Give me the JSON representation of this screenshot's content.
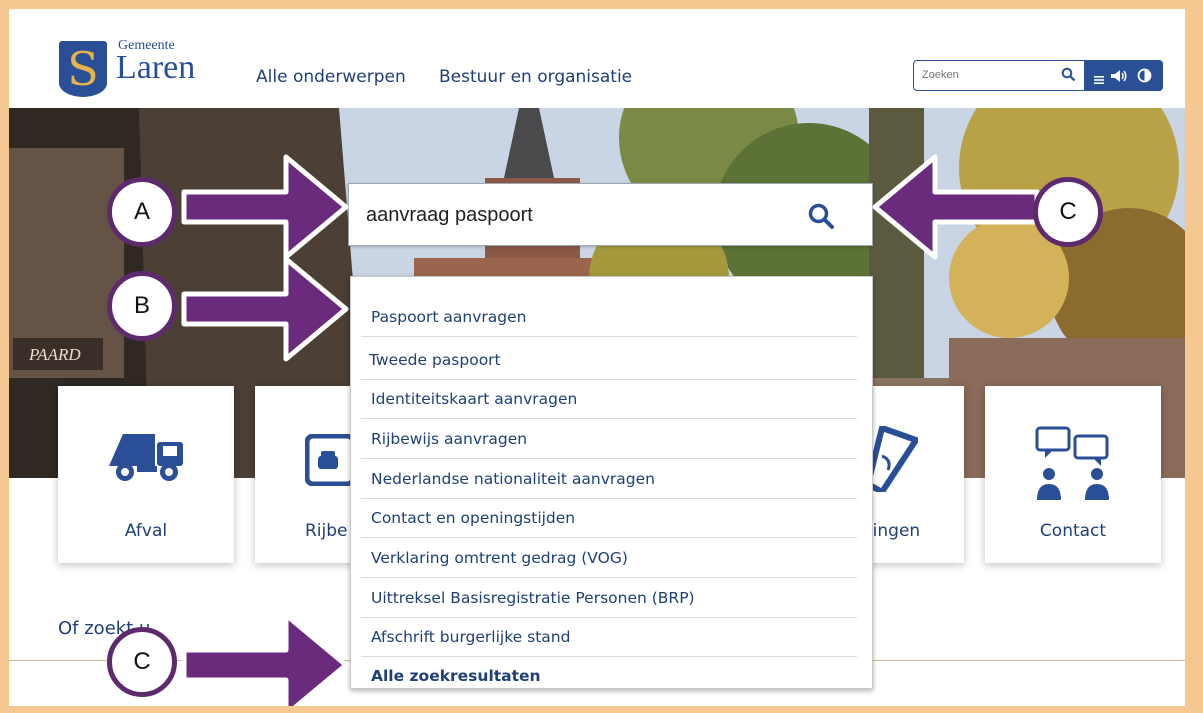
{
  "header": {
    "logo_letter": "S",
    "logo_small": "Gemeente",
    "logo_big": "Laren",
    "nav": [
      "Alle onderwerpen",
      "Bestuur en organisatie"
    ],
    "search_placeholder": "Zoeken"
  },
  "main_search": {
    "value": "aanvraag paspoort"
  },
  "suggestions": [
    "Paspoort aanvragen",
    "Tweede paspoort",
    "Identiteitskaart aanvragen",
    "Rijbewijs aanvragen",
    "Nederlandse nationaliteit aanvragen",
    "Contact en openingstijden",
    "Verklaring omtrent gedrag (VOG)",
    "Uittreksel Basisregistratie Personen (BRP)",
    "Afschrift burgerlijke stand",
    "Alle zoekresultaten"
  ],
  "tiles": [
    "Afval",
    "Rijbe",
    "tingen",
    "Contact"
  ],
  "hero_sign_text": "PAARD",
  "bottom_text": "Of zoekt u",
  "callouts": [
    "A",
    "B",
    "C",
    "C"
  ],
  "colors": {
    "brand": "#2a4f97",
    "arrow": "#6b2b7d",
    "frame": "#f4c890"
  }
}
